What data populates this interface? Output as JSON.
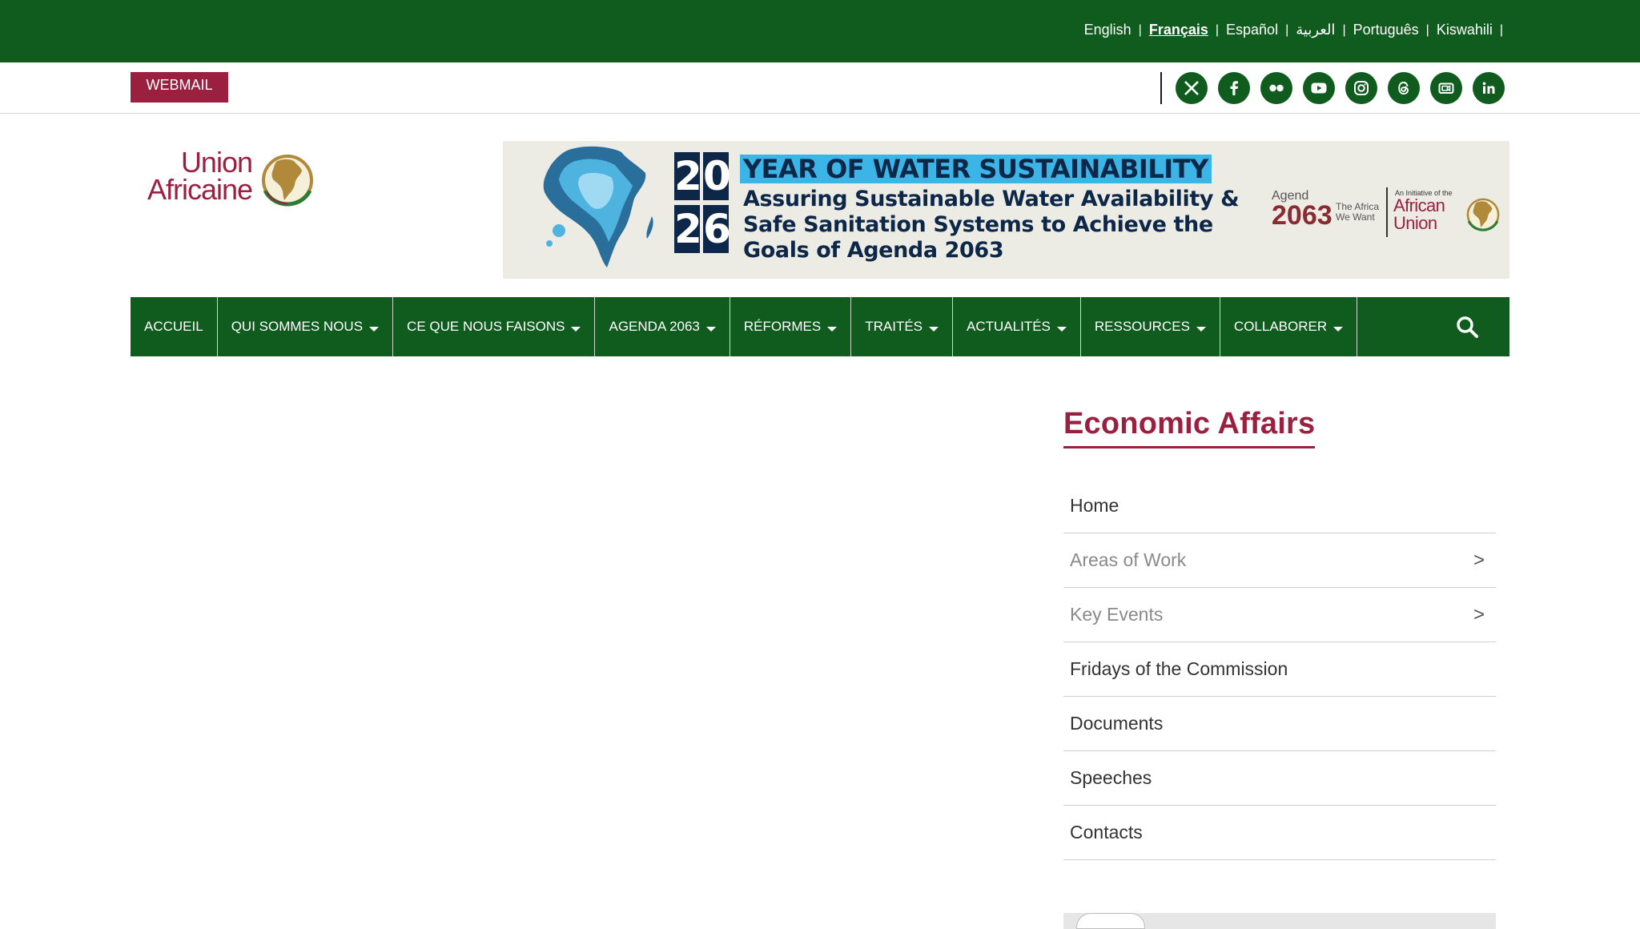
{
  "languages": [
    {
      "label": "English",
      "active": false
    },
    {
      "label": "Français",
      "active": true
    },
    {
      "label": "Español",
      "active": false
    },
    {
      "label": "العربية",
      "active": false
    },
    {
      "label": "Português",
      "active": false
    },
    {
      "label": "Kiswahili",
      "active": false
    }
  ],
  "utility": {
    "webmail_label": "WEBMAIL",
    "social_icons": [
      "x-icon",
      "facebook-icon",
      "flickr-icon",
      "youtube-icon",
      "instagram-icon",
      "threads-icon",
      "video-icon",
      "linkedin-icon"
    ]
  },
  "logo": {
    "line1": "Union",
    "line2": "Africaine"
  },
  "banner": {
    "year_top": [
      "2",
      "0"
    ],
    "year_bottom": [
      "2",
      "6"
    ],
    "title": "YEAR OF WATER SUSTAINABILITY",
    "subtitle_1": "Assuring Sustainable Water Availability &",
    "subtitle_2": "Safe Sanitation Systems to Achieve the",
    "subtitle_3": "Goals of Agenda 2063",
    "agenda_small": "Agend",
    "agenda_big": "2063",
    "agenda_tag": "The Africa We Want",
    "initiative": "An Initiative of the",
    "au_line1": "African",
    "au_line2": "Union"
  },
  "nav": {
    "items": [
      {
        "label": "ACCUEIL",
        "dropdown": false
      },
      {
        "label": "QUI SOMMES NOUS",
        "dropdown": true
      },
      {
        "label": "CE QUE NOUS FAISONS",
        "dropdown": true
      },
      {
        "label": "AGENDA 2063",
        "dropdown": true
      },
      {
        "label": "RÉFORMES",
        "dropdown": true
      },
      {
        "label": "TRAITÉS",
        "dropdown": true
      },
      {
        "label": "ACTUALITÉS",
        "dropdown": true
      },
      {
        "label": "RESSOURCES",
        "dropdown": true
      },
      {
        "label": "COLLABORER",
        "dropdown": true
      }
    ]
  },
  "sidebar": {
    "title": "Economic Affairs",
    "items": [
      {
        "label": "Home",
        "muted": false,
        "arrow": ""
      },
      {
        "label": "Areas of Work",
        "muted": true,
        "arrow": ">"
      },
      {
        "label": "Key Events",
        "muted": true,
        "arrow": ">"
      },
      {
        "label": "Fridays of the Commission",
        "muted": false,
        "arrow": ""
      },
      {
        "label": "Documents",
        "muted": false,
        "arrow": ""
      },
      {
        "label": "Speeches",
        "muted": false,
        "arrow": ""
      },
      {
        "label": "Contacts",
        "muted": false,
        "arrow": ""
      }
    ]
  },
  "colors": {
    "brand_green": "#105b1e",
    "brand_maroon": "#9b2040",
    "banner_navy": "#0d2748",
    "banner_blue": "#3ab5e6"
  }
}
